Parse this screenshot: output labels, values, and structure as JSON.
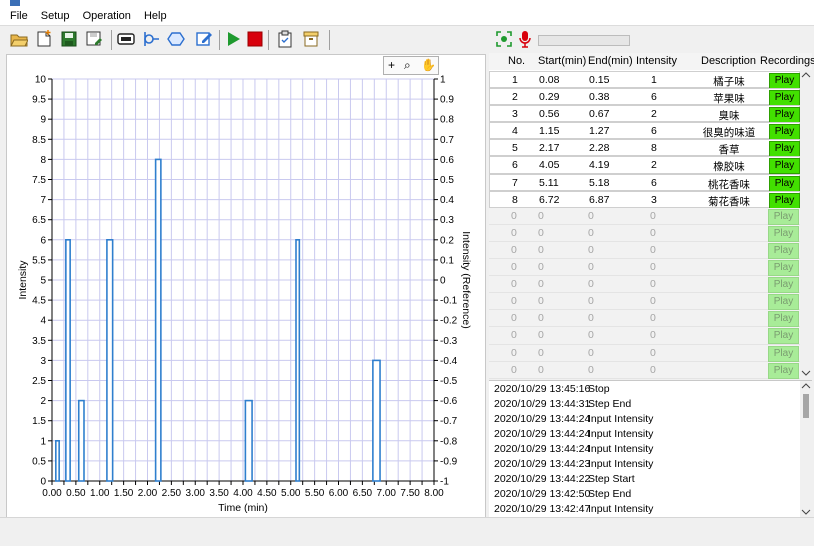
{
  "menu": [
    "File",
    "Setup",
    "Operation",
    "Help"
  ],
  "toolbar": {
    "left_icons": [
      "open-folder-icon",
      "new-file-icon",
      "save-icon",
      "save-as-icon",
      "device-icon",
      "connect-icon",
      "hexagon-icon",
      "edit-icon",
      "start-icon",
      "stop-icon",
      "clipboard-icon",
      "archive-icon"
    ],
    "right_icons": [
      "screenshot-icon",
      "microphone-icon"
    ]
  },
  "chart_data": {
    "type": "bar",
    "xlabel": "Time (min)",
    "ylabel": "Intensity",
    "y2label": "Intensity (Reference)",
    "xlim": [
      0,
      8
    ],
    "ylim": [
      0,
      10
    ],
    "y2lim": [
      -1,
      1
    ],
    "xticks": [
      "0.00",
      "0.25",
      "0.50",
      "0.75",
      "1.00",
      "1.25",
      "1.50",
      "1.75",
      "2.00",
      "2.25",
      "2.50",
      "2.75",
      "3.00",
      "3.25",
      "3.50",
      "3.75",
      "4.00",
      "4.25",
      "4.50",
      "4.75",
      "5.00",
      "5.25",
      "5.50",
      "5.75",
      "6.00",
      "6.25",
      "6.50",
      "6.75",
      "7.00",
      "7.25",
      "7.50",
      "7.75",
      "8.00"
    ],
    "yticks": [
      "0",
      "0.5",
      "1",
      "1.5",
      "2",
      "2.5",
      "3",
      "3.5",
      "4",
      "4.5",
      "5",
      "5.5",
      "6",
      "6.5",
      "7",
      "7.5",
      "8",
      "8.5",
      "9",
      "9.5",
      "10"
    ],
    "y2ticks": [
      "-1",
      "-0.9",
      "-0.8",
      "-0.7",
      "-0.6",
      "-0.5",
      "-0.4",
      "-0.3",
      "-0.2",
      "-0.1",
      "0",
      "0.1",
      "0.2",
      "0.3",
      "0.4",
      "0.5",
      "0.6",
      "0.7",
      "0.8",
      "0.9",
      "1"
    ],
    "bars": [
      {
        "start": 0.08,
        "end": 0.15,
        "value": 1
      },
      {
        "start": 0.29,
        "end": 0.38,
        "value": 6
      },
      {
        "start": 0.56,
        "end": 0.67,
        "value": 2
      },
      {
        "start": 1.15,
        "end": 1.27,
        "value": 6
      },
      {
        "start": 2.17,
        "end": 2.28,
        "value": 8
      },
      {
        "start": 4.05,
        "end": 4.19,
        "value": 2
      },
      {
        "start": 5.11,
        "end": 5.18,
        "value": 6
      },
      {
        "start": 6.72,
        "end": 6.87,
        "value": 3
      }
    ],
    "grid": true,
    "colors": {
      "bar": "#2f7fce",
      "grid": "#c9c9ef"
    }
  },
  "chart_tools": [
    "+",
    "⌕",
    "✋"
  ],
  "table": {
    "headers": [
      "No.",
      "Start(min)",
      "End(min)",
      "Intensity",
      "Description",
      "Recordings"
    ],
    "rows": [
      {
        "no": "1",
        "start": "0.08",
        "end": "0.15",
        "intensity": "1",
        "desc": "橘子味",
        "rec": "Play"
      },
      {
        "no": "2",
        "start": "0.29",
        "end": "0.38",
        "intensity": "6",
        "desc": "苹果味",
        "rec": "Play"
      },
      {
        "no": "3",
        "start": "0.56",
        "end": "0.67",
        "intensity": "2",
        "desc": "臭味",
        "rec": "Play"
      },
      {
        "no": "4",
        "start": "1.15",
        "end": "1.27",
        "intensity": "6",
        "desc": "很臭的味道",
        "rec": "Play"
      },
      {
        "no": "5",
        "start": "2.17",
        "end": "2.28",
        "intensity": "8",
        "desc": "香草",
        "rec": "Play"
      },
      {
        "no": "6",
        "start": "4.05",
        "end": "4.19",
        "intensity": "2",
        "desc": "橡胶味",
        "rec": "Play"
      },
      {
        "no": "7",
        "start": "5.11",
        "end": "5.18",
        "intensity": "6",
        "desc": "桃花香味",
        "rec": "Play"
      },
      {
        "no": "8",
        "start": "6.72",
        "end": "6.87",
        "intensity": "3",
        "desc": "菊花香味",
        "rec": "Play"
      }
    ],
    "empty_row": {
      "value": "0",
      "rec": "Play"
    },
    "empty_count": 10
  },
  "log": [
    {
      "time": "2020/10/29 13:45:16",
      "msg": "Stop"
    },
    {
      "time": "2020/10/29 13:44:31",
      "msg": "Step End"
    },
    {
      "time": "2020/10/29 13:44:24",
      "msg": "Input Intensity"
    },
    {
      "time": "2020/10/29 13:44:24",
      "msg": "Input Intensity"
    },
    {
      "time": "2020/10/29 13:44:24",
      "msg": "Input Intensity"
    },
    {
      "time": "2020/10/29 13:44:23",
      "msg": "Input Intensity"
    },
    {
      "time": "2020/10/29 13:44:22",
      "msg": "Step Start"
    },
    {
      "time": "2020/10/29 13:42:50",
      "msg": "Step End"
    },
    {
      "time": "2020/10/29 13:42:47",
      "msg": "Input Intensity"
    }
  ]
}
